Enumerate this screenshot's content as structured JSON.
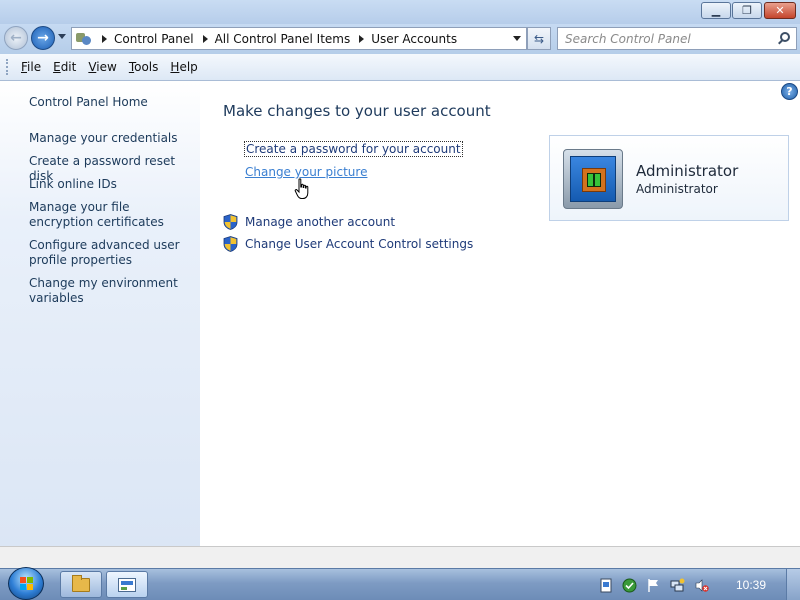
{
  "window": {
    "min_label": "▁",
    "max_label": "❐",
    "close_label": "✕"
  },
  "address": {
    "crumbs": [
      "Control Panel",
      "All Control Panel Items",
      "User Accounts"
    ],
    "refresh_label": "⇆"
  },
  "search": {
    "placeholder": "Search Control Panel"
  },
  "menu": [
    "File",
    "Edit",
    "View",
    "Tools",
    "Help"
  ],
  "sidebar": {
    "home": "Control Panel Home",
    "links": [
      "Manage your credentials",
      "Create a password reset disk",
      "Link online IDs",
      "Manage your file encryption certificates",
      "Configure advanced user profile properties",
      "Change my environment variables"
    ]
  },
  "main": {
    "title": "Make changes to your user account",
    "actions": [
      "Create a password for your account",
      "Change your picture",
      "Manage another account",
      "Change User Account Control settings"
    ],
    "help_label": "?"
  },
  "account": {
    "name": "Administrator",
    "role": "Administrator"
  },
  "taskbar": {
    "clock": "10:39"
  },
  "icons": {
    "shield_colors": [
      "#2a63c9",
      "#f2c230"
    ]
  }
}
